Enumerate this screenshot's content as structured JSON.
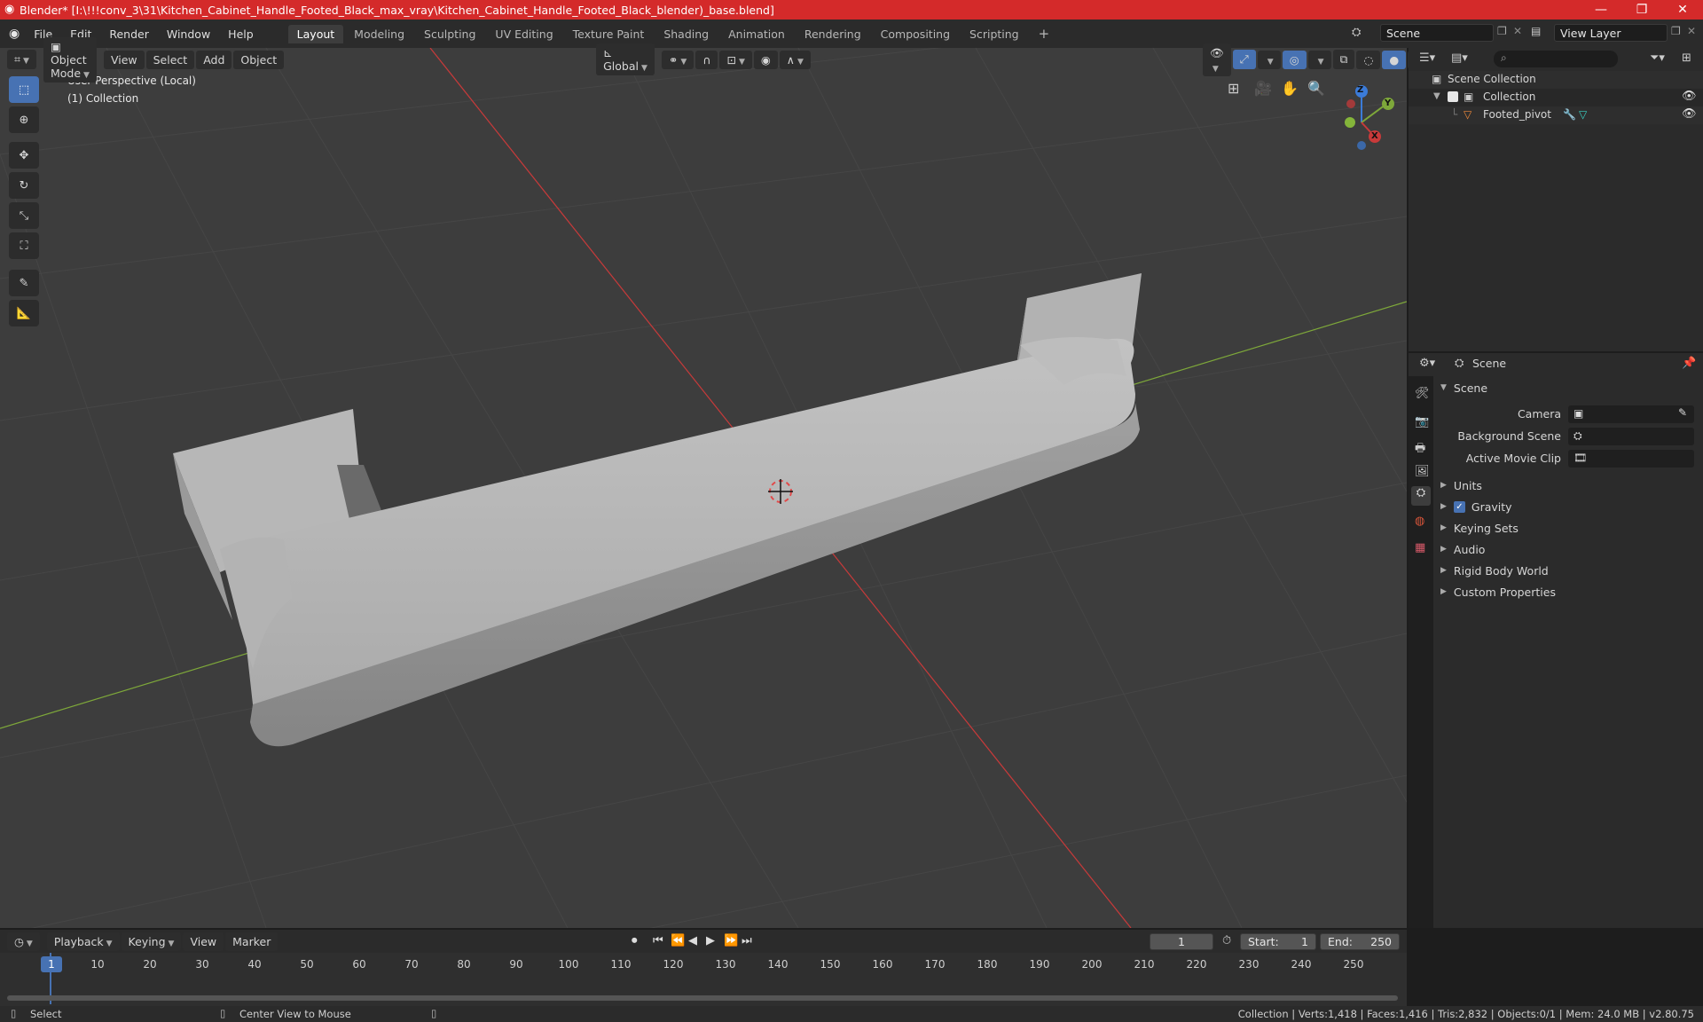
{
  "window": {
    "title": "Blender* [I:\\!!!conv_3\\31\\Kitchen_Cabinet_Handle_Footed_Black_max_vray\\Kitchen_Cabinet_Handle_Footed_Black_blender)_base.blend]",
    "minimize": "—",
    "maximize": "❐",
    "close": "✕"
  },
  "menubar": {
    "items": [
      "File",
      "Edit",
      "Render",
      "Window",
      "Help"
    ],
    "workspaces": [
      "Layout",
      "Modeling",
      "Sculpting",
      "UV Editing",
      "Texture Paint",
      "Shading",
      "Animation",
      "Rendering",
      "Compositing",
      "Scripting"
    ],
    "active_workspace": "Layout",
    "add_tab": "+",
    "scene_name": "Scene",
    "view_layer": "View Layer"
  },
  "viewport": {
    "mode": "Object Mode",
    "menus": [
      "View",
      "Select",
      "Add",
      "Object"
    ],
    "transform_orientation": "Global",
    "perspective_label": "User Perspective (Local)",
    "collection_label": "(1) Collection",
    "gizmo": {
      "x": "X",
      "y": "Y",
      "z": "Z"
    }
  },
  "outliner": {
    "root": "Scene Collection",
    "collection": "Collection",
    "object": "Footed_pivot"
  },
  "properties": {
    "context": "Scene",
    "panel": "Scene",
    "camera_label": "Camera",
    "background_scene_label": "Background Scene",
    "active_movie_clip_label": "Active Movie Clip",
    "sections": [
      "Units",
      "Gravity",
      "Keying Sets",
      "Audio",
      "Rigid Body World",
      "Custom Properties"
    ]
  },
  "timeline": {
    "menus": [
      "Playback",
      "Keying",
      "View",
      "Marker"
    ],
    "current_frame": "1",
    "start_label": "Start:",
    "start": "1",
    "end_label": "End:",
    "end": "250",
    "ticks": [
      "1",
      "10",
      "20",
      "30",
      "40",
      "50",
      "60",
      "70",
      "80",
      "90",
      "100",
      "110",
      "120",
      "130",
      "140",
      "150",
      "160",
      "170",
      "180",
      "190",
      "200",
      "210",
      "220",
      "230",
      "240",
      "250"
    ]
  },
  "statusbar": {
    "select": "Select",
    "center_view": "Center View to Mouse",
    "stats": "Collection | Verts:1,418 | Faces:1,416 | Tris:2,832 | Objects:0/1 | Mem: 24.0 MB | v2.80.75"
  },
  "colors": {
    "titlebar": "#d42a2a",
    "viewport_bg": "#3d3d3d",
    "accent": "#4772b3",
    "x_axis": "#c83a3a",
    "y_axis": "#7ea83a",
    "z_axis": "#3b7bd8"
  }
}
